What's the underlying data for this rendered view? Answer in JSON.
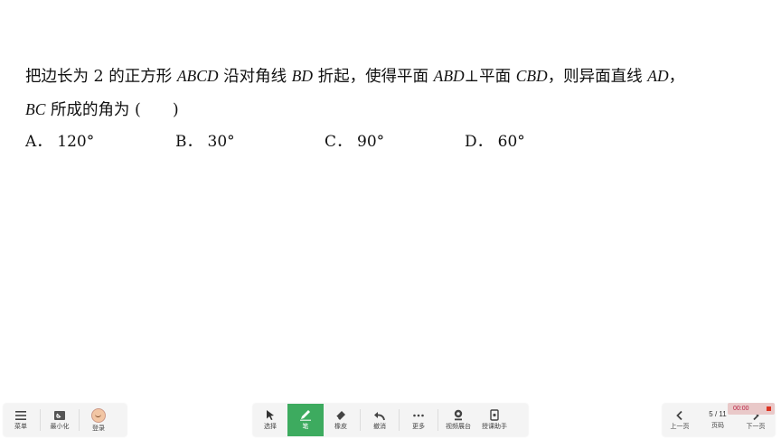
{
  "question": {
    "line1": [
      {
        "t": "把边长为 2 的正方形 ",
        "i": false
      },
      {
        "t": "ABCD",
        "i": true
      },
      {
        "t": " 沿对角线 ",
        "i": false
      },
      {
        "t": "BD",
        "i": true
      },
      {
        "t": " 折起，使得平面 ",
        "i": false
      },
      {
        "t": "ABD",
        "i": true
      },
      {
        "t": "⊥平面 ",
        "i": false
      },
      {
        "t": "CBD",
        "i": true
      },
      {
        "t": "，则异面直线 ",
        "i": false
      },
      {
        "t": "AD",
        "i": true
      },
      {
        "t": "，",
        "i": false
      }
    ],
    "line2": [
      {
        "t": "BC",
        "i": true
      },
      {
        "t": " 所成的角为 (　　)",
        "i": false
      }
    ]
  },
  "options": [
    {
      "letter": "A",
      "value": "120°"
    },
    {
      "letter": "B",
      "value": "30°"
    },
    {
      "letter": "C",
      "value": "90°"
    },
    {
      "letter": "D",
      "value": "60°"
    }
  ],
  "option_sep": "．",
  "toolbar_left": {
    "menu": "菜单",
    "minimize": "最小化",
    "login": "登录"
  },
  "toolbar_center": {
    "select": "选择",
    "pen": "笔",
    "eraser": "橡皮",
    "undo": "撤消",
    "more": "更多",
    "camera": "视频展台",
    "assistant": "授课助手"
  },
  "toolbar_right": {
    "prev": "上一页",
    "page_indicator": "5 / 11",
    "page_label": "页码",
    "next": "下一页"
  },
  "timer": "00:00",
  "colors": {
    "active": "#3dab5f",
    "timer_bg": "#e9c9c9",
    "record": "#dd3322"
  }
}
